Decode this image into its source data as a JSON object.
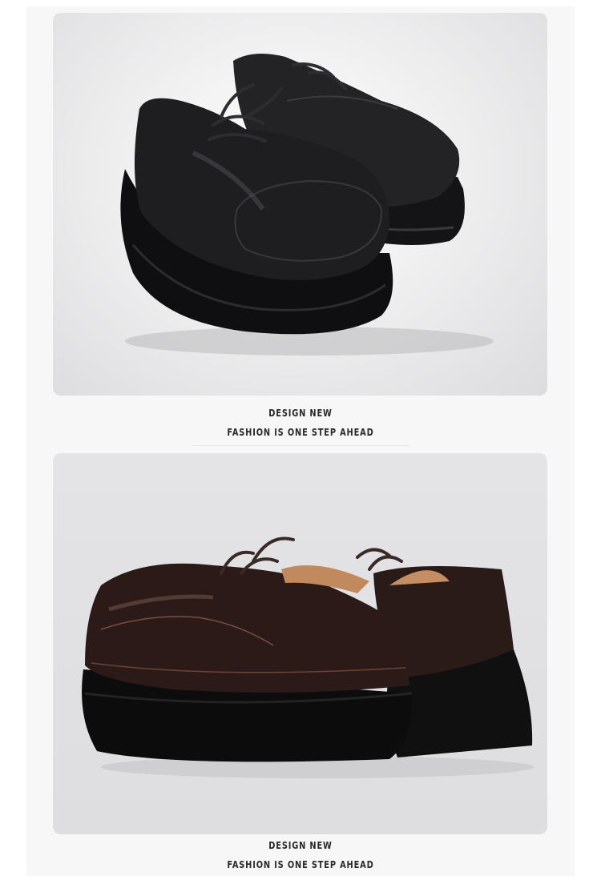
{
  "sections": [
    {
      "line1": "DESIGN NEW",
      "line2": "FASHION IS ONE STEP AHEAD"
    },
    {
      "line1": "DESIGN NEW",
      "line2": "FASHION IS ONE STEP AHEAD"
    }
  ],
  "colors": {
    "black_leather": "#1c1c1e",
    "brown_leather": "#2b1a18",
    "sole": "#111111",
    "lining": "#c08a5e"
  }
}
